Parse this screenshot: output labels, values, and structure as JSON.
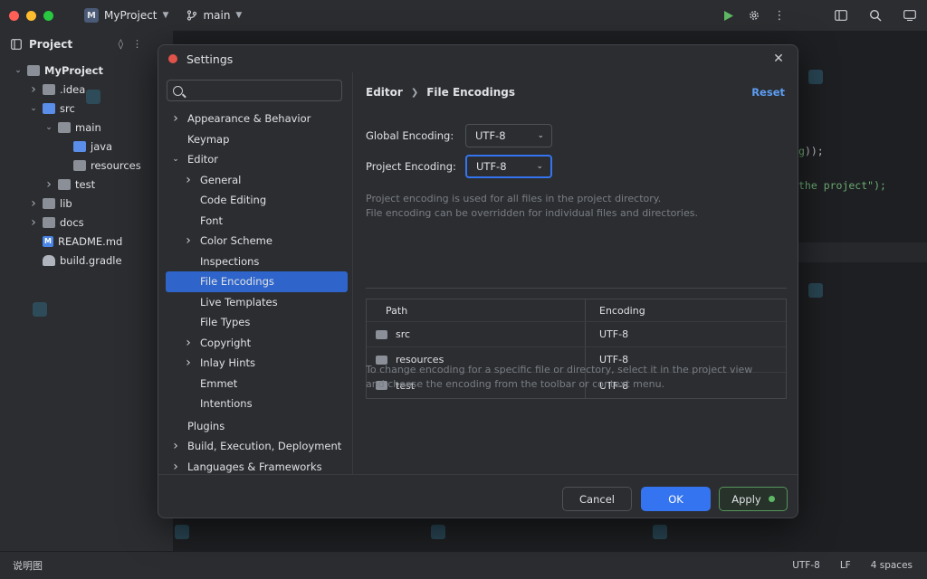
{
  "titlebar": {
    "project_badge": "M",
    "project_name": "MyProject",
    "branch": "main"
  },
  "project_panel": {
    "title": "Project",
    "tree": [
      {
        "label": "MyProject",
        "level": 0,
        "expanded": true,
        "icon": "folder-icon"
      },
      {
        "label": ".idea",
        "level": 1,
        "expanded": false,
        "icon": "folder-icon"
      },
      {
        "label": "src",
        "level": 1,
        "expanded": true,
        "icon": "folder-icon"
      },
      {
        "label": "main",
        "level": 2,
        "expanded": true,
        "icon": "folder-icon"
      },
      {
        "label": "java",
        "level": 3,
        "icon": "source-folder-icon"
      },
      {
        "label": "resources",
        "level": 3,
        "icon": "resources-folder-icon"
      },
      {
        "label": "test",
        "level": 2,
        "expanded": false,
        "icon": "folder-icon"
      },
      {
        "label": "lib",
        "level": 1,
        "expanded": false,
        "icon": "folder-icon"
      },
      {
        "label": "docs",
        "level": 1,
        "expanded": false,
        "icon": "folder-icon"
      },
      {
        "label": "README.md",
        "level": 1,
        "icon": "markdown-file-icon"
      },
      {
        "label": "build.gradle",
        "level": 1,
        "icon": "gradle-icon"
      }
    ]
  },
  "editor": {
    "code_fragment_1": "g));",
    "code_fragment_2": " the project\");"
  },
  "dialog": {
    "title": "Settings",
    "search_value": "",
    "nav": [
      {
        "label": "Appearance & Behavior",
        "level": 0,
        "chevron": "right"
      },
      {
        "label": "Keymap",
        "level": 0,
        "chevron": ""
      },
      {
        "label": "Editor",
        "level": 0,
        "chevron": "down"
      },
      {
        "label": "General",
        "level": 1,
        "chevron": "right"
      },
      {
        "label": "Code Editing",
        "level": 1,
        "chevron": ""
      },
      {
        "label": "Font",
        "level": 1,
        "chevron": ""
      },
      {
        "label": "Color Scheme",
        "level": 1,
        "chevron": "right"
      },
      {
        "label": "Inspections",
        "level": 1,
        "chevron": ""
      },
      {
        "label": "File Encodings",
        "level": 1,
        "chevron": "",
        "selected": true
      },
      {
        "label": "Live Templates",
        "level": 1,
        "chevron": ""
      },
      {
        "label": "File Types",
        "level": 1,
        "chevron": ""
      },
      {
        "label": "Copyright",
        "level": 1,
        "chevron": "right"
      },
      {
        "label": "Inlay Hints",
        "level": 1,
        "chevron": "right"
      },
      {
        "label": "Emmet",
        "level": 1,
        "chevron": ""
      },
      {
        "label": "Intentions",
        "level": 1,
        "chevron": ""
      },
      {
        "label": "Plugins",
        "level": 0,
        "chevron": ""
      },
      {
        "label": "Build, Execution, Deployment",
        "level": 0,
        "chevron": "right"
      },
      {
        "label": "Languages & Frameworks",
        "level": 0,
        "chevron": "right"
      }
    ],
    "breadcrumb": {
      "parent": "Editor",
      "current": "File Encodings"
    },
    "reset_label": "Reset",
    "global_encoding_label": "Global Encoding:",
    "global_encoding_value": "UTF-8",
    "project_encoding_label": "Project Encoding:",
    "project_encoding_value": "UTF-8",
    "hint_1": "Project encoding is used for all files in the project directory.",
    "hint_2": "File encoding can be overridden for individual files and directories.",
    "table": {
      "headers": [
        "Path",
        "Encoding"
      ],
      "rows": [
        {
          "path": "src",
          "encoding": "UTF-8"
        },
        {
          "path": "resources",
          "encoding": "UTF-8"
        },
        {
          "path": "test",
          "encoding": "UTF-8"
        }
      ]
    },
    "footer_hint_1": "To change encoding for a specific file or directory, select it in the project view",
    "footer_hint_2": "and choose the encoding from the toolbar or context menu.",
    "cancel_label": "Cancel",
    "ok_label": "OK",
    "apply_label": "Apply"
  },
  "statusbar": {
    "left_text": "说明图",
    "encoding": "UTF-8",
    "line_separator": "LF",
    "indent": "4 spaces"
  },
  "colors": {
    "accent": "#3574f0",
    "selection": "#2f65ca",
    "link": "#5c9df3",
    "apply_border": "#57965c",
    "close_dot": "#e0534b"
  }
}
